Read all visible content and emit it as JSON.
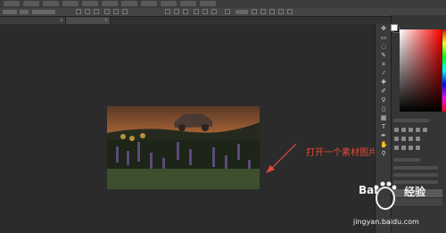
{
  "document": {
    "tabs": [
      {
        "label": "",
        "active": false
      },
      {
        "label": "",
        "active": true
      }
    ]
  },
  "panels": {
    "foreground_color": "#ffffff",
    "background_color": "#000000",
    "picker_hue": "#ff0000"
  },
  "annotation": {
    "text": "打开一个素材图片",
    "color": "#e24a3d"
  },
  "watermark": {
    "brand": "Bai",
    "brand_suffix": "经验",
    "url": "jingyan.baidu.com"
  }
}
